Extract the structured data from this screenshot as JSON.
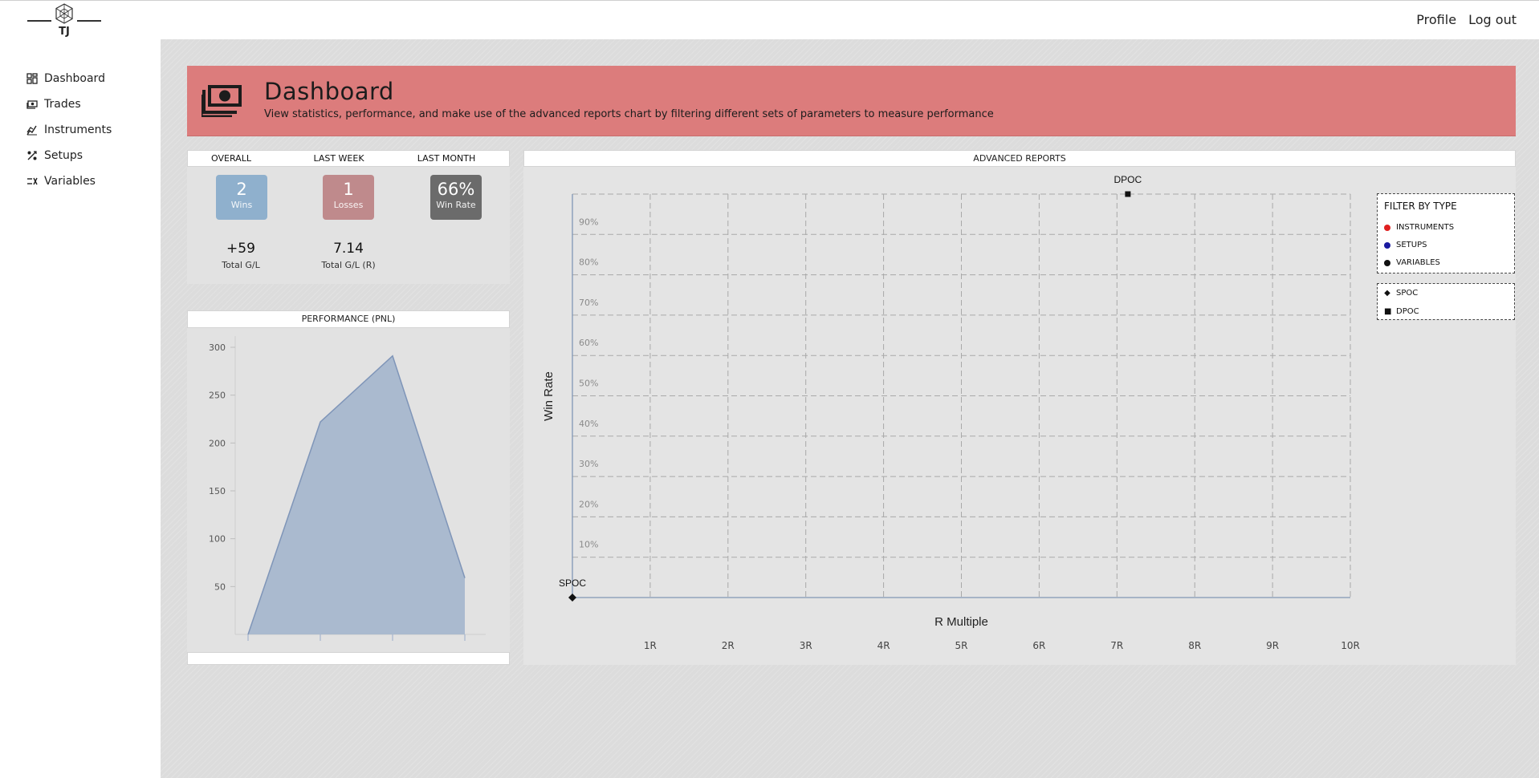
{
  "brand": {
    "logo_text": "TJ"
  },
  "topnav": {
    "profile": "Profile",
    "logout": "Log out"
  },
  "sidebar": {
    "items": [
      {
        "label": "Dashboard",
        "icon": "dashboard-icon"
      },
      {
        "label": "Trades",
        "icon": "money-icon"
      },
      {
        "label": "Instruments",
        "icon": "chart-icon"
      },
      {
        "label": "Setups",
        "icon": "setups-icon"
      },
      {
        "label": "Variables",
        "icon": "variables-icon"
      }
    ]
  },
  "banner": {
    "title": "Dashboard",
    "subtitle": "View statistics, performance, and make use of the advanced reports chart by filtering different sets of parameters to measure performance",
    "color": "#dc7c7c",
    "icon": "money-icon"
  },
  "stats": {
    "headers": [
      "OVERALL",
      "LAST WEEK",
      "LAST MONTH"
    ],
    "wins": {
      "value": "2",
      "label": "Wins",
      "color": "#8fb0cd"
    },
    "losses": {
      "value": "1",
      "label": "Losses",
      "color": "#bf8a8c"
    },
    "winrate": {
      "value": "66%",
      "label": "Win Rate",
      "color": "#6b6b6b"
    },
    "total_gl": {
      "value": "+59",
      "label": "Total G/L"
    },
    "total_gl_r": {
      "value": "7.14",
      "label": "Total G/L (R)"
    }
  },
  "performance": {
    "title": "PERFORMANCE (PNL)"
  },
  "advanced": {
    "title": "ADVANCED REPORTS",
    "filter_title": "FILTER BY TYPE",
    "filters": [
      {
        "label": "INSTRUMENTS",
        "color": "#e02020"
      },
      {
        "label": "SETUPS",
        "color": "#1a1aa0"
      },
      {
        "label": "VARIABLES",
        "color": "#111111"
      }
    ],
    "symbols": [
      {
        "label": "SPOC",
        "symbol": "◆"
      },
      {
        "label": "DPOC",
        "symbol": "■"
      }
    ]
  },
  "chart_data": [
    {
      "type": "area",
      "title": "PERFORMANCE (PNL)",
      "x": [
        1,
        2,
        3,
        4
      ],
      "y": [
        0,
        222,
        291,
        59
      ],
      "ylim": [
        0,
        300
      ],
      "yticks": [
        50,
        100,
        150,
        200,
        250,
        300
      ],
      "color": "#a7b7cd"
    },
    {
      "type": "scatter",
      "title": "ADVANCED REPORTS",
      "xlabel": "R Multiple",
      "ylabel": "Win Rate",
      "xticks": [
        "1R",
        "2R",
        "3R",
        "4R",
        "5R",
        "6R",
        "7R",
        "8R",
        "9R",
        "10R"
      ],
      "yticks": [
        "10%",
        "20%",
        "30%",
        "40%",
        "50%",
        "60%",
        "70%",
        "80%",
        "90%"
      ],
      "xlim": [
        0,
        10
      ],
      "ylim": [
        0,
        100
      ],
      "grid": true,
      "points": [
        {
          "name": "SPOC",
          "x": 0,
          "y": 0,
          "symbol": "diamond"
        },
        {
          "name": "DPOC",
          "x": 7.14,
          "y": 100,
          "symbol": "square"
        }
      ]
    }
  ]
}
